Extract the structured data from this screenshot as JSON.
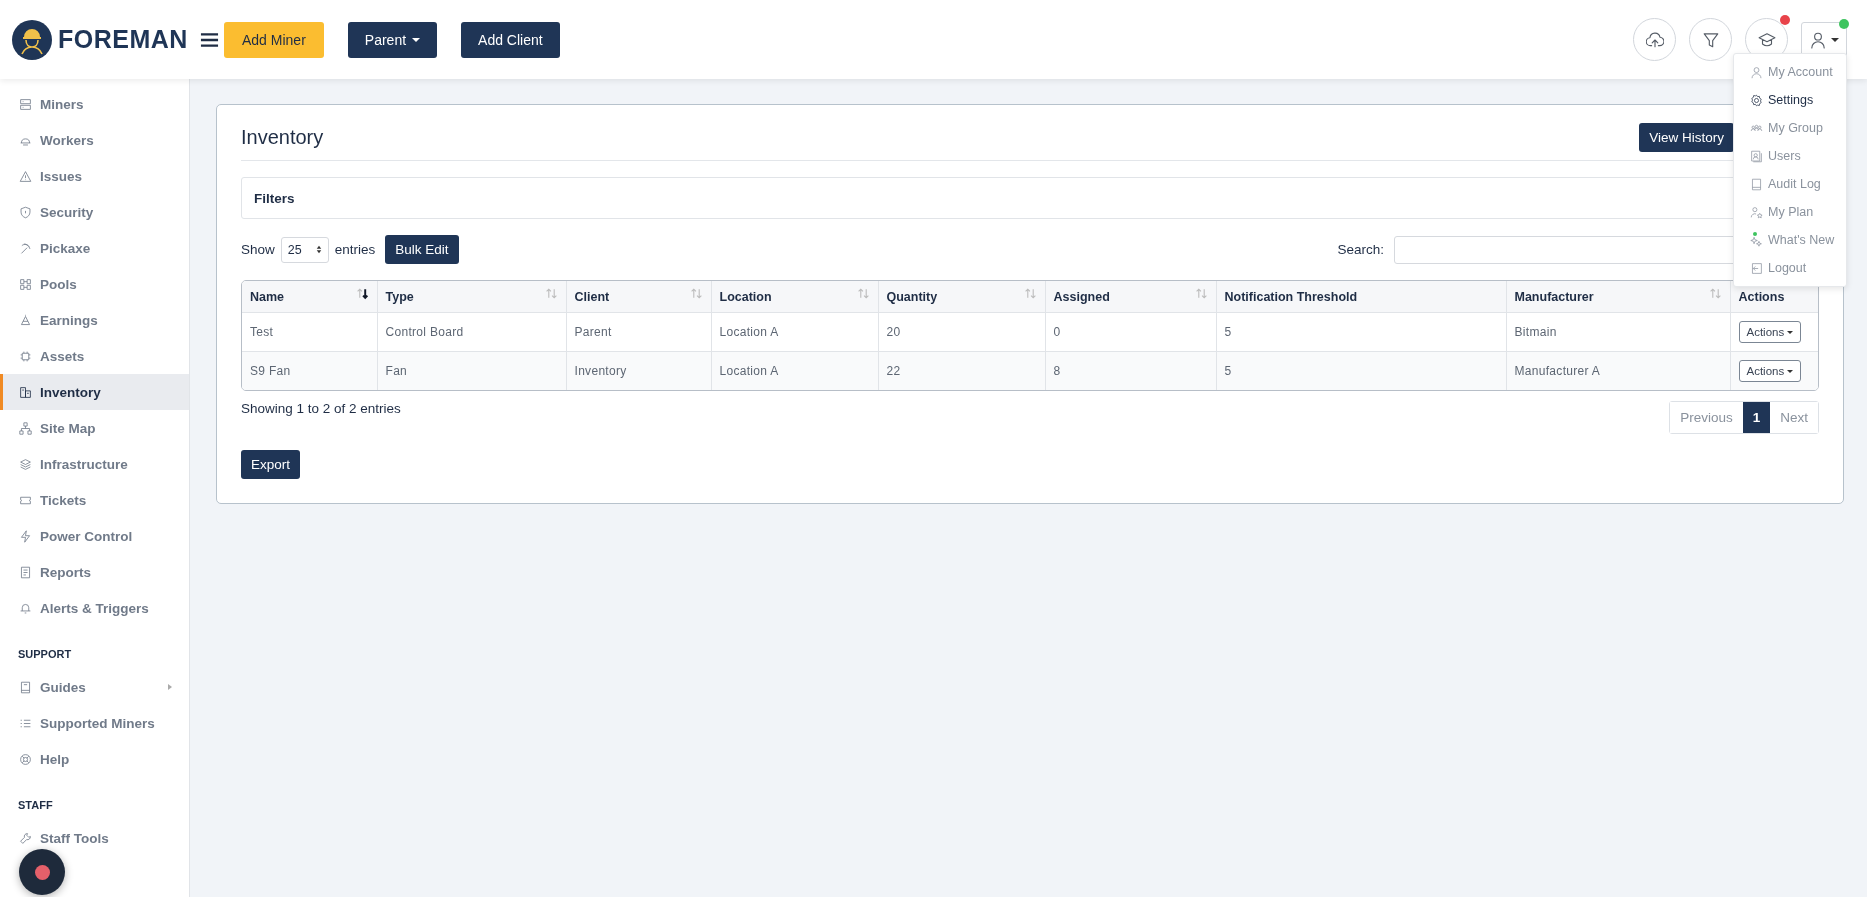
{
  "header": {
    "logo": "FOREMAN",
    "buttons": [
      {
        "label": "Add Miner",
        "kind": "primary",
        "caret": false
      },
      {
        "label": "Parent",
        "kind": "dark",
        "caret": true
      },
      {
        "label": "Add Client",
        "kind": "dark",
        "caret": false
      }
    ],
    "icon_buttons": [
      {
        "kind": "upload"
      },
      {
        "kind": "filter"
      },
      {
        "kind": "learn",
        "color": "#e8434a"
      },
      {
        "kind": "account",
        "color": "#3ec45f"
      }
    ]
  },
  "sidebar": {
    "sections": [
      {
        "items": [
          {
            "label": "Miners",
            "selected": false
          },
          {
            "label": "Workers",
            "selected": false
          },
          {
            "label": "Issues",
            "selected": false
          },
          {
            "label": "Security",
            "selected": false
          },
          {
            "label": "Pickaxe",
            "selected": false
          },
          {
            "label": "Pools",
            "selected": false
          },
          {
            "label": "Earnings",
            "selected": false
          },
          {
            "label": "Assets",
            "selected": false
          },
          {
            "label": "Inventory",
            "selected": true
          },
          {
            "label": "Site Map",
            "selected": false
          },
          {
            "label": "Infrastructure",
            "selected": false
          },
          {
            "label": "Tickets",
            "selected": false
          },
          {
            "label": "Power Control",
            "selected": false
          },
          {
            "label": "Reports",
            "selected": false
          },
          {
            "label": "Alerts & Triggers",
            "selected": false
          }
        ]
      },
      {
        "heading": "SUPPORT",
        "items": [
          {
            "label": "Guides",
            "selected": false,
            "expandable": true
          },
          {
            "label": "Supported Miners",
            "selected": false
          },
          {
            "label": "Help",
            "selected": false
          }
        ]
      },
      {
        "heading": "STAFF",
        "items": [
          {
            "label": "Staff Tools",
            "selected": false
          }
        ]
      }
    ]
  },
  "page": {
    "title": "Inventory",
    "view_history": "View History",
    "filters": "Filters",
    "show_label": "Show",
    "page_size": "25",
    "entries_label": "entries",
    "bulk_edit": "Bulk Edit",
    "search_label": "Search:",
    "table": {
      "columns": [
        {
          "label": "Name",
          "sortable": true,
          "sorted": true
        },
        {
          "label": "Type",
          "sortable": true,
          "sorted": false
        },
        {
          "label": "Client",
          "sortable": true,
          "sorted": false
        },
        {
          "label": "Location",
          "sortable": true,
          "sorted": false
        },
        {
          "label": "Quantity",
          "sortable": true,
          "sorted": false
        },
        {
          "label": "Assigned",
          "sortable": true,
          "sorted": false
        },
        {
          "label": "Notification Threshold",
          "sortable": false
        },
        {
          "label": "Manufacturer",
          "sortable": true,
          "sorted": false
        },
        {
          "label": "Actions",
          "sortable": false
        }
      ],
      "rows": [
        [
          "Test",
          "Control Board",
          "Parent",
          "Location A",
          "20",
          "0",
          "5",
          "Bitmain",
          "Actions"
        ],
        [
          "S9 Fan",
          "Fan",
          "Inventory",
          "Location A",
          "22",
          "8",
          "5",
          "Manufacturer A",
          "Actions"
        ]
      ]
    },
    "info": "Showing 1 to 2 of 2 entries",
    "pagination": [
      {
        "label": "Previous",
        "selected": false
      },
      {
        "label": "1",
        "selected": true
      },
      {
        "label": "Next",
        "selected": false
      }
    ],
    "export": "Export"
  },
  "user_menu": {
    "items": [
      {
        "label": "My Account",
        "selected": false,
        "new_dot": false
      },
      {
        "label": "Settings",
        "selected": true,
        "new_dot": false
      },
      {
        "label": "My Group",
        "selected": false,
        "new_dot": false
      },
      {
        "label": "Users",
        "selected": false,
        "new_dot": false
      },
      {
        "label": "Audit Log",
        "selected": false,
        "new_dot": false
      },
      {
        "label": "My Plan",
        "selected": false,
        "new_dot": false
      },
      {
        "label": "What's New",
        "selected": false,
        "new_dot": true
      },
      {
        "label": "Logout",
        "selected": false,
        "new_dot": false
      }
    ]
  }
}
